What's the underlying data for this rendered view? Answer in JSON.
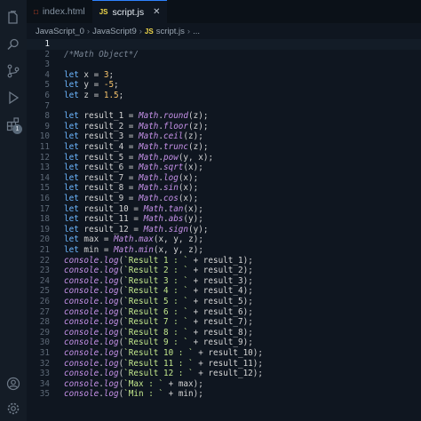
{
  "tabs": [
    {
      "label": "index.html",
      "icon": "html-file-icon",
      "active": false
    },
    {
      "label": "script.js",
      "icon": "js-file-icon",
      "active": true
    }
  ],
  "breadcrumb": [
    "JavaScript_0",
    "JavaScript9",
    "script.js",
    "..."
  ],
  "activity_badge": "1",
  "code": [
    "",
    "/*Math Object*/",
    "",
    "let x = 3;",
    "let y = -5;",
    "let z = 1.5;",
    "",
    "let result_1 = Math.round(z);",
    "let result_2 = Math.floor(z);",
    "let result_3 = Math.ceil(z);",
    "let result_4 = Math.trunc(z);",
    "let result_5 = Math.pow(y, x);",
    "let result_6 = Math.sqrt(x);",
    "let result_7 = Math.log(x);",
    "let result_8 = Math.sin(x);",
    "let result_9 = Math.cos(x);",
    "let result_10 = Math.tan(x);",
    "let result_11 = Math.abs(y);",
    "let result_12 = Math.sign(y);",
    "let max = Math.max(x, y, z);",
    "let min = Math.min(x, y, z);",
    "console.log(`Result 1 : ` + result_1);",
    "console.log(`Result 2 : ` + result_2);",
    "console.log(`Result 3 : ` + result_3);",
    "console.log(`Result 4 : ` + result_4);",
    "console.log(`Result 5 : ` + result_5);",
    "console.log(`Result 6 : ` + result_6);",
    "console.log(`Result 7 : ` + result_7);",
    "console.log(`Result 8 : ` + result_8);",
    "console.log(`Result 9 : ` + result_9);",
    "console.log(`Result 10 : ` + result_10);",
    "console.log(`Result 11 : ` + result_11);",
    "console.log(`Result 12 : ` + result_12);",
    "console.log(`Max : ` + max);",
    "console.log(`Min : ` + min);"
  ],
  "current_line": 1
}
